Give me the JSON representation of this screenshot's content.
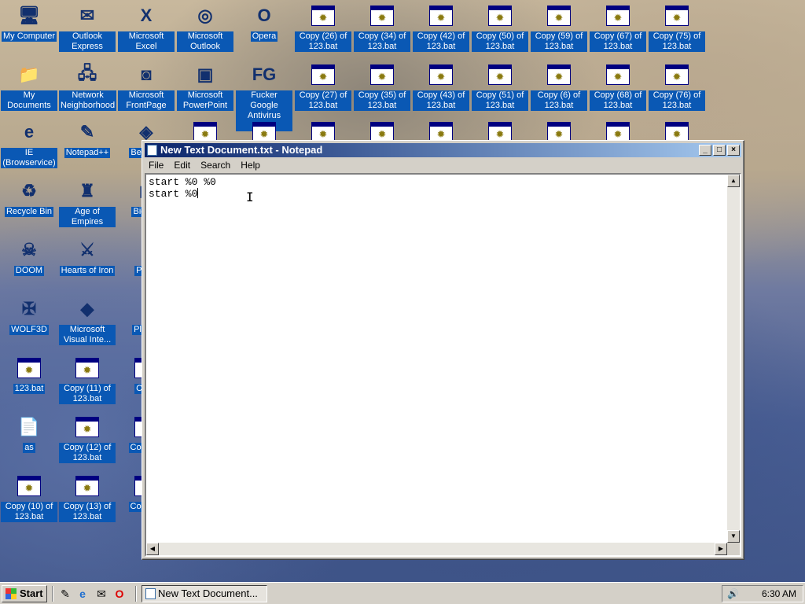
{
  "desktop": {
    "col1": [
      {
        "label": "My Computer",
        "glyph": "🖥"
      },
      {
        "label": "My Documents",
        "glyph": "📁"
      },
      {
        "label": "IE (Browservice)",
        "glyph": "e"
      },
      {
        "label": "Recycle Bin",
        "glyph": "♻"
      },
      {
        "label": "DOOM",
        "glyph": "☠"
      },
      {
        "label": "WOLF3D",
        "glyph": "✠"
      },
      {
        "label": "123.bat",
        "glyph": "bat"
      },
      {
        "label": "as",
        "glyph": "📄"
      },
      {
        "label": "Copy (10) of 123.bat",
        "glyph": "bat"
      }
    ],
    "col2": [
      {
        "label": "Outlook Express",
        "glyph": "✉"
      },
      {
        "label": "Network Neighborhood",
        "glyph": "🖧"
      },
      {
        "label": "Notepad++",
        "glyph": "✎"
      },
      {
        "label": "Age of Empires",
        "glyph": "♜"
      },
      {
        "label": "Hearts of Iron",
        "glyph": "⚔"
      },
      {
        "label": "Microsoft Visual Inte...",
        "glyph": "◆"
      },
      {
        "label": "Copy (11) of 123.bat",
        "glyph": "bat"
      },
      {
        "label": "Copy (12) of 123.bat",
        "glyph": "bat"
      },
      {
        "label": "Copy (13) of 123.bat",
        "glyph": "bat"
      }
    ],
    "col3_partial": [
      {
        "label": "Beje De",
        "glyph": "◈"
      },
      {
        "label": "Big De",
        "glyph": "◼"
      },
      {
        "label": "Pegg",
        "glyph": "●"
      },
      {
        "label": "Pla Zo",
        "glyph": "●"
      },
      {
        "label": "Copy",
        "glyph": "bat"
      },
      {
        "label": "Copy 12",
        "glyph": "bat"
      },
      {
        "label": "Copy 12",
        "glyph": "bat"
      }
    ],
    "row1": [
      {
        "label": "Microsoft Excel",
        "glyph": "X"
      },
      {
        "label": "Microsoft Outlook",
        "glyph": "◎"
      },
      {
        "label": "Opera",
        "glyph": "O"
      },
      {
        "label": "Copy (26) of 123.bat",
        "glyph": "bat"
      },
      {
        "label": "Copy (34) of 123.bat",
        "glyph": "bat"
      },
      {
        "label": "Copy (42) of 123.bat",
        "glyph": "bat"
      },
      {
        "label": "Copy (50) of 123.bat",
        "glyph": "bat"
      },
      {
        "label": "Copy (59) of 123.bat",
        "glyph": "bat"
      },
      {
        "label": "Copy (67) of 123.bat",
        "glyph": "bat"
      },
      {
        "label": "Copy (75) of 123.bat",
        "glyph": "bat"
      }
    ],
    "row2": [
      {
        "label": "Microsoft FrontPage",
        "glyph": "◙"
      },
      {
        "label": "Microsoft PowerPoint",
        "glyph": "▣"
      },
      {
        "label": "Fucker Google Antivirus 2010",
        "glyph": "FG"
      },
      {
        "label": "Copy (27) of 123.bat",
        "glyph": "bat"
      },
      {
        "label": "Copy (35) of 123.bat",
        "glyph": "bat"
      },
      {
        "label": "Copy (43) of 123.bat",
        "glyph": "bat"
      },
      {
        "label": "Copy (51) of 123.bat",
        "glyph": "bat"
      },
      {
        "label": "Copy (6) of 123.bat",
        "glyph": "bat"
      },
      {
        "label": "Copy (68) of 123.bat",
        "glyph": "bat"
      },
      {
        "label": "Copy (76) of 123.bat",
        "glyph": "bat"
      }
    ]
  },
  "notepad": {
    "title": "New Text Document.txt - Notepad",
    "menu": {
      "file": "File",
      "edit": "Edit",
      "search": "Search",
      "help": "Help"
    },
    "content_line1": "start %0 %0",
    "content_line2": "start %0"
  },
  "taskbar": {
    "start_label": "Start",
    "task_label": "New Text Document...",
    "clock": "6:30 AM"
  }
}
